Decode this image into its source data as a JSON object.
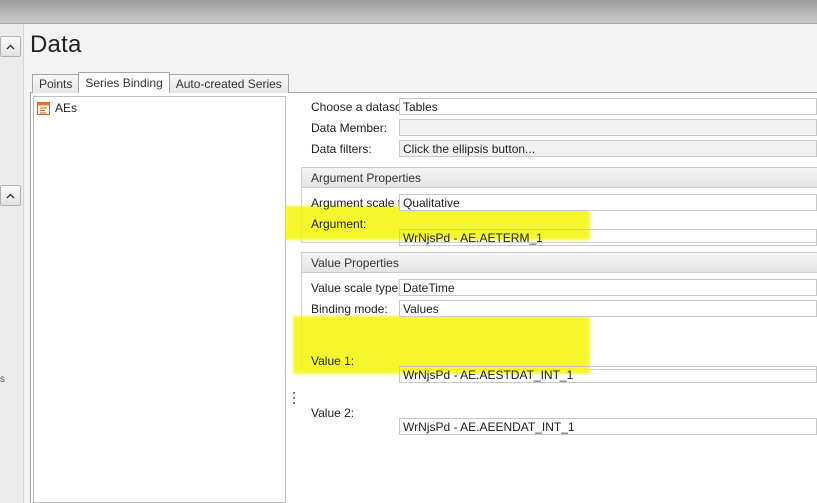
{
  "page": {
    "title": "Data"
  },
  "tabs": [
    {
      "label": "Points",
      "active": false
    },
    {
      "label": "Series Binding",
      "active": true
    },
    {
      "label": "Auto-created Series",
      "active": false
    }
  ],
  "left_strip": {
    "partial_text": "s"
  },
  "series_list": {
    "items": [
      {
        "label": "AEs",
        "icon": "table-series-icon"
      }
    ]
  },
  "datasource": {
    "choose_label": "Choose a datasou",
    "choose_value": "Tables",
    "member_label": "Data Member:",
    "member_value": "",
    "filters_label": "Data filters:",
    "filters_value": "Click the ellipsis button..."
  },
  "argument_properties": {
    "header": "Argument Properties",
    "scale_label": "Argument scale typ",
    "scale_value": "Qualitative",
    "argument_label": "Argument:",
    "argument_value": "WrNjsPd - AE.AETERM_1"
  },
  "value_properties": {
    "header": "Value Properties",
    "scale_label": "Value scale type:",
    "scale_value": "DateTime",
    "binding_label": "Binding mode:",
    "binding_value": "Values",
    "value1_label": "Value 1:",
    "value1_value": "WrNjsPd - AE.AESTDAT_INT_1",
    "value2_label": "Value 2:",
    "value2_value": "WrNjsPd - AE.AEENDAT_INT_1"
  },
  "colors": {
    "highlight": "#f4f60e",
    "border": "#a7a7a7"
  }
}
